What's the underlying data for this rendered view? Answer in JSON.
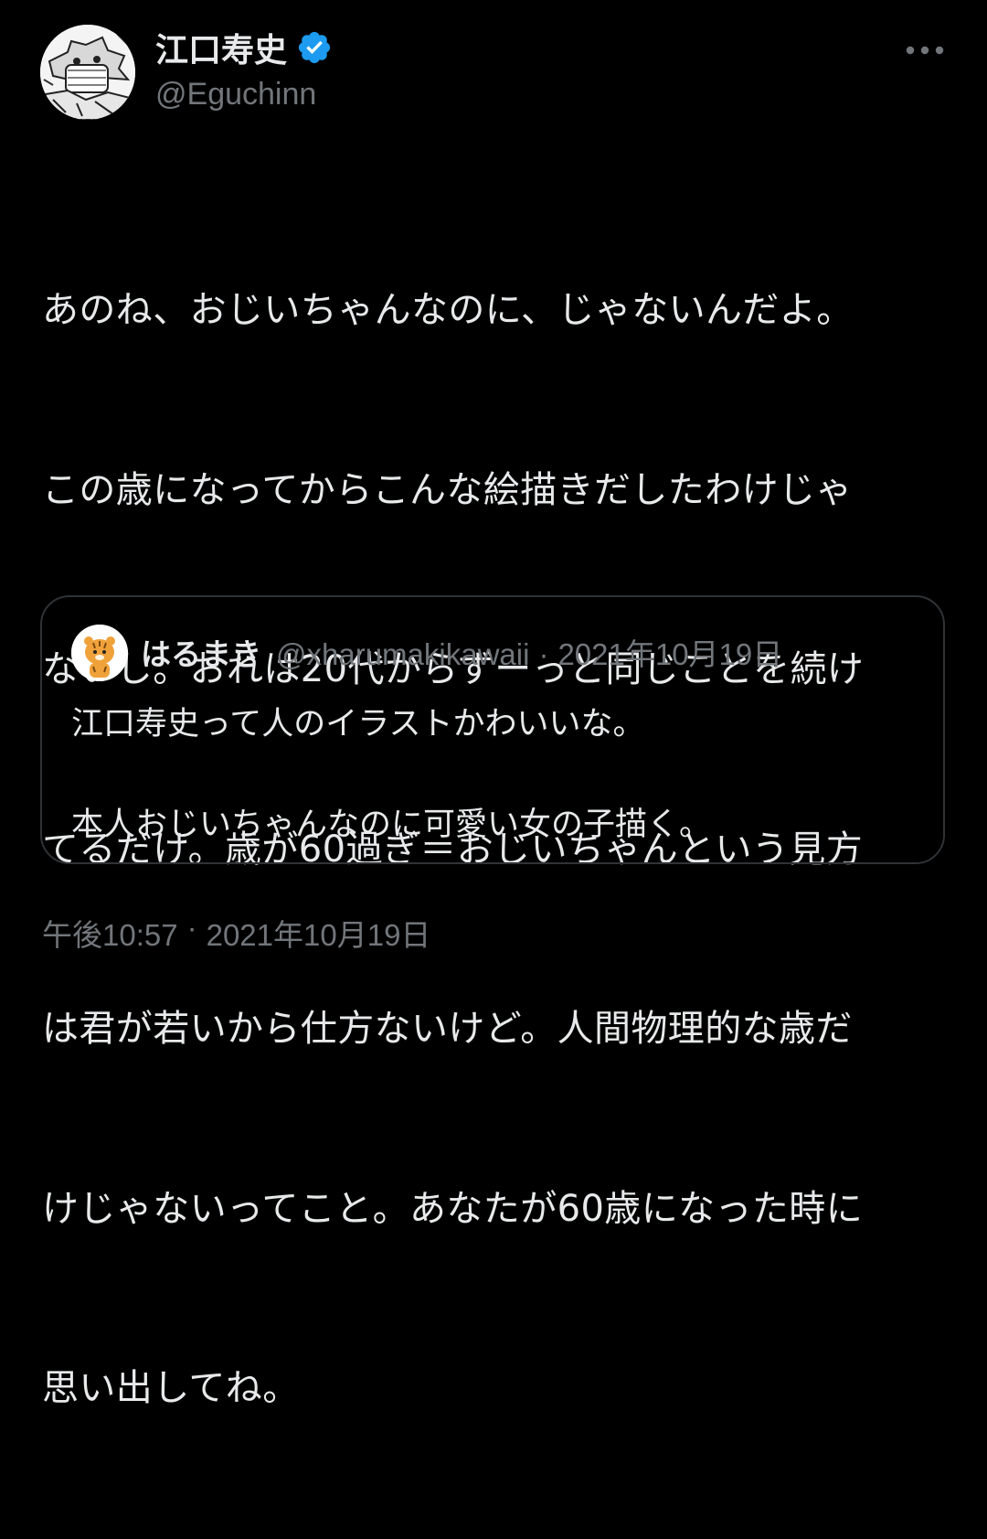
{
  "tweet": {
    "author": {
      "display_name": "江口寿史",
      "handle": "@Eguchinn",
      "verified": true,
      "avatar_icon": "manga-illustration-avatar"
    },
    "more_icon": "more-horizontal-icon",
    "text_lines": [
      "あのね、おじいちゃんなのに、じゃないんだよ。",
      "この歳になってからこんな絵描きだしたわけじゃ",
      "ないし。おれは20代からずーっと同じことを続け",
      "てるだけ。歳が60過ぎ＝おじいちゃんという見方",
      "は君が若いから仕方ないけど。人間物理的な歳だ",
      "けじゃないってこと。あなたが60歳になった時に",
      "思い出してね。"
    ],
    "quote": {
      "display_name": "はるまき",
      "handle": "@xharumakikawaii",
      "separator": "·",
      "date": "2021年10月19日",
      "avatar_icon": "tiger-avatar",
      "line1": "江口寿史って人のイラストかわいいな。",
      "line2": "本人おじいちゃんなのに可愛い女の子描く。"
    },
    "timestamp": {
      "time": "午後10:57",
      "separator": "·",
      "date": "2021年10月19日"
    }
  },
  "colors": {
    "background": "#000000",
    "primary_text": "#e7e9ea",
    "secondary_text": "#71767b",
    "border": "#2f3336",
    "verified_blue": "#1d9bf0"
  }
}
